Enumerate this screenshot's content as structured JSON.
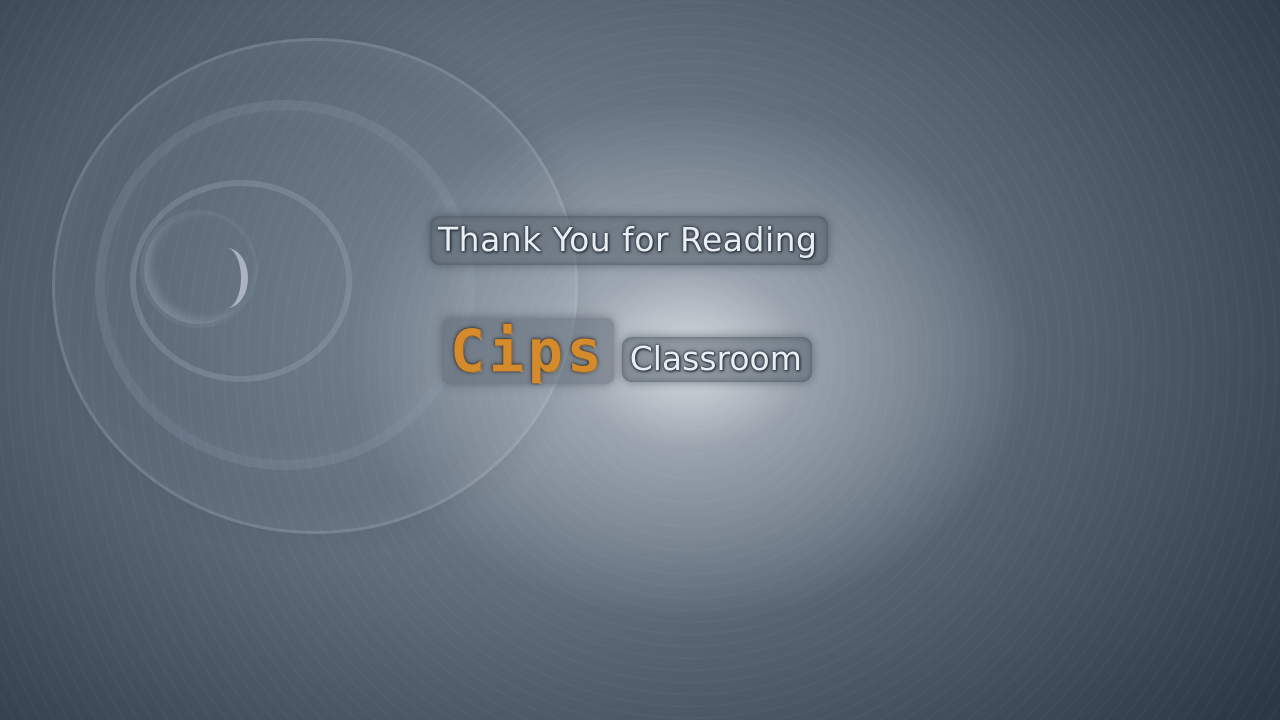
{
  "slide": {
    "title": "Thank You for Reading",
    "brand": {
      "logo_text": "Cips",
      "name": "Classroom"
    }
  },
  "colors": {
    "logo": "#d58a2c",
    "text": "#e9eef3",
    "background_dark": "#2b3846",
    "background_light": "#eef1f4"
  }
}
